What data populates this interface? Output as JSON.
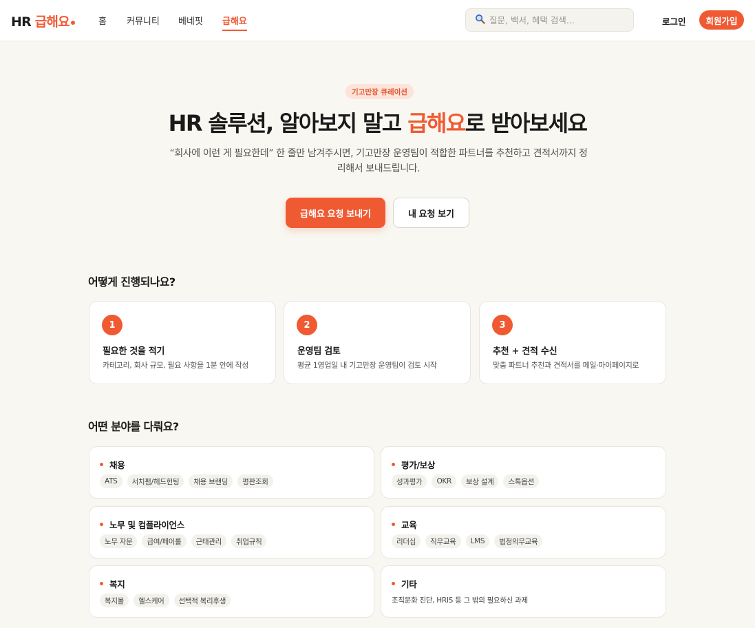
{
  "header": {
    "logo_prefix": "HR ",
    "logo_accent": "급해요",
    "nav": [
      "홈",
      "커뮤니티",
      "베네핏",
      "급해요"
    ],
    "active_nav": "급해요",
    "search_placeholder": "질문, 백서, 혜택 검색...",
    "search_icon": "magnifier-icon",
    "login_label": "로그인",
    "signup_label": "회원가입"
  },
  "hero": {
    "badge": "기고만장 큐레이션",
    "title_before": "HR 솔루션, 알아보지 말고 ",
    "title_accent": "급해요",
    "title_after": "로 받아보세요",
    "description": "“회사에 이런 게 필요한데” 한 줄만 남겨주시면, 기고만장 운영팀이 적합한 파트너를 추천하고 견적서까지 정리해서 보내드립니다.",
    "primary_button": "급해요 요청 보내기",
    "secondary_button": "내 요청 보기"
  },
  "process": {
    "title": "어떻게 진행되나요?",
    "steps": [
      {
        "num": "1",
        "title": "필요한 것을 적기",
        "desc": "카테고리, 회사 규모, 필요 사항을 1분 안에 작성"
      },
      {
        "num": "2",
        "title": "운영팀 검토",
        "desc": "평균 1영업일 내 기고만장 운영팀이 검토 시작"
      },
      {
        "num": "3",
        "title": "추천 + 견적 수신",
        "desc": "맞춤 파트너 추천과 견적서를 메일·마이페이지로"
      }
    ]
  },
  "areas": {
    "title": "어떤 분야를 다뤄요?",
    "items": [
      {
        "title": "채용",
        "tags": [
          "ATS",
          "서치펌/헤드헌팅",
          "채용 브랜딩",
          "평판조회"
        ]
      },
      {
        "title": "평가/보상",
        "tags": [
          "성과평가",
          "OKR",
          "보상 설계",
          "스톡옵션"
        ]
      },
      {
        "title": "노무 및 컴플라이언스",
        "tags": [
          "노무 자문",
          "급여/페이롤",
          "근태관리",
          "취업규칙"
        ]
      },
      {
        "title": "교육",
        "tags": [
          "리더십",
          "직무교육",
          "LMS",
          "법정의무교육"
        ]
      },
      {
        "title": "복지",
        "tags": [
          "복지몰",
          "헬스케어",
          "선택적 복리후생"
        ]
      },
      {
        "title": "기타",
        "note": "조직문화 진단, HRIS 등 그 밖의 필요하신 과제"
      }
    ]
  },
  "colors": {
    "accent": "#f05a33",
    "background": "#f8f7f1"
  }
}
